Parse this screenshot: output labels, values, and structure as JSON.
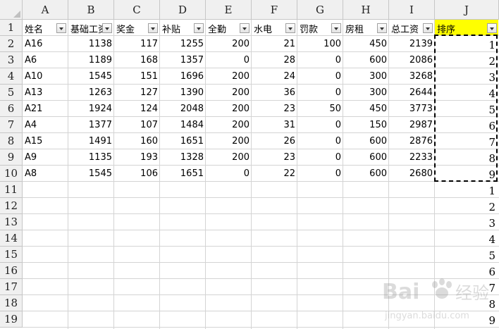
{
  "columns": [
    "A",
    "B",
    "C",
    "D",
    "E",
    "F",
    "G",
    "H",
    "I",
    "J"
  ],
  "rows": [
    "1",
    "2",
    "3",
    "4",
    "5",
    "6",
    "7",
    "8",
    "9",
    "10",
    "11",
    "12",
    "13",
    "14",
    "15",
    "16",
    "17",
    "18",
    "19"
  ],
  "headers": [
    "姓名",
    "基础工资",
    "奖金",
    "补贴",
    "全勤",
    "水电",
    "罚款",
    "房租",
    "总工资",
    "排序"
  ],
  "data": [
    [
      "A16",
      "1138",
      "117",
      "1255",
      "200",
      "21",
      "100",
      "450",
      "2139",
      "1"
    ],
    [
      "A6",
      "1189",
      "168",
      "1357",
      "0",
      "28",
      "0",
      "600",
      "2086",
      "2"
    ],
    [
      "A10",
      "1545",
      "151",
      "1696",
      "200",
      "24",
      "0",
      "300",
      "3268",
      "3"
    ],
    [
      "A13",
      "1263",
      "127",
      "1390",
      "200",
      "36",
      "0",
      "300",
      "2644",
      "4"
    ],
    [
      "A21",
      "1924",
      "124",
      "2048",
      "200",
      "23",
      "50",
      "450",
      "3773",
      "5"
    ],
    [
      "A4",
      "1377",
      "107",
      "1484",
      "200",
      "31",
      "0",
      "150",
      "2987",
      "6"
    ],
    [
      "A15",
      "1491",
      "160",
      "1651",
      "200",
      "26",
      "0",
      "600",
      "2876",
      "7"
    ],
    [
      "A9",
      "1135",
      "193",
      "1328",
      "200",
      "23",
      "0",
      "600",
      "2233",
      "8"
    ],
    [
      "A8",
      "1545",
      "106",
      "1651",
      "0",
      "22",
      "0",
      "600",
      "2680",
      "9"
    ]
  ],
  "extra_j": [
    "1",
    "2",
    "3",
    "4",
    "5",
    "6",
    "7",
    "8",
    "9"
  ],
  "watermark": {
    "brand": "Bai",
    "suffix": "经验",
    "url": "jingyan.baidu.com"
  },
  "colors": {
    "highlight": "#ffff00",
    "header_bg": "#f0f0f0",
    "gridline": "#d4d4d4"
  }
}
